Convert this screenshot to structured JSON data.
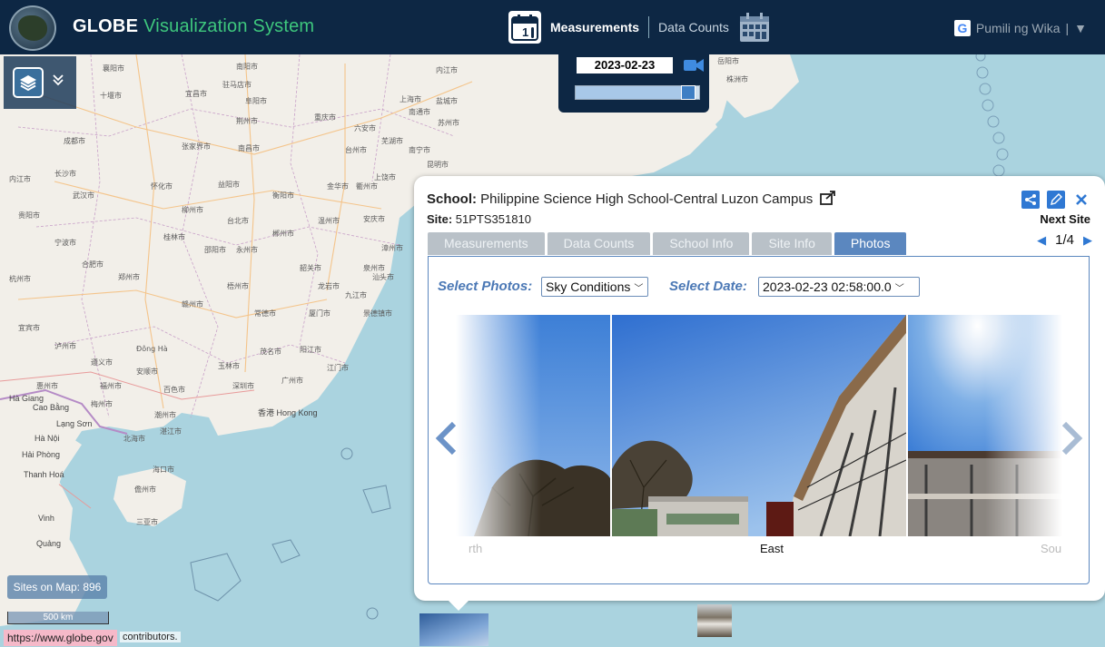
{
  "header": {
    "title_part1": "GLOBE",
    "title_part2": "Visualization System",
    "nav": {
      "measurements_label": "Measurements",
      "data_counts_label": "Data Counts",
      "calendar_day": "1"
    },
    "language_label": "Pumili ng Wika",
    "language_separator": "|",
    "language_caret": "▼",
    "google_letter": "G"
  },
  "date_widget": {
    "date": "2023-02-23",
    "slider_value": 0.97
  },
  "map": {
    "sites_on_map": "Sites on Map: 896",
    "scale_label": "500 km",
    "url": "https://www.globe.gov",
    "attribution": "contributors.",
    "place_labels": [
      "香港 Hong Kong",
      "Hà Nội",
      "Hải Phòng",
      "Thanh Hoá",
      "Vinh",
      "Hà Giang",
      "Lạng Sơn",
      "Cao Bằng",
      "海口市",
      "儋州市",
      "三亚市",
      "湛江市",
      "北海市",
      "广州市",
      "深圳市",
      "汕头市",
      "厦门市",
      "福州市",
      "温州市",
      "台北市",
      "南昌市",
      "长沙市",
      "武汉市",
      "贵阳市",
      "南宁市",
      "昆明市",
      "重庆市",
      "成都市",
      "杭州市",
      "宁波市",
      "合肥市",
      "郑州市",
      "十堰市",
      "襄阳市",
      "宜昌市",
      "荆州市",
      "张家界市",
      "怀化市",
      "柳州市",
      "桂林市",
      "梧州市",
      "韶关市",
      "赣州市",
      "龙岩市",
      "泉州市",
      "漳州市",
      "九江市",
      "景德镇市",
      "上饶市",
      "衢州市",
      "金华市",
      "台州市",
      "安庆市",
      "黄山市",
      "信阳市",
      "南阳市",
      "驻马店市",
      "阜阳市",
      "六安市",
      "芜湖市",
      "苏州市",
      "上海市",
      "南通市",
      "盐城市",
      "内江市",
      "自贡市",
      "宜宾市",
      "泸州市",
      "遵义市",
      "安顺市",
      "百色市",
      "玉林市",
      "茂名市",
      "阳江市",
      "江门市",
      "惠州市",
      "梅州市",
      "潮州市",
      "岳阳市",
      "株洲市",
      "衡阳市",
      "永州市",
      "郴州市",
      "邵阳市",
      "益阳市",
      "常德市",
      "Đông Hà",
      "Quảng"
    ]
  },
  "popup": {
    "school_label": "School:",
    "school_name": "Philippine Science High School-Central Luzon Campus",
    "site_label": "Site:",
    "site_id": "51PTS351810",
    "next_site_label": "Next Site",
    "pager": "1/4",
    "tabs": [
      "Measurements",
      "Data Counts",
      "School Info",
      "Site Info",
      "Photos"
    ],
    "active_tab": "Photos",
    "select_photos_label": "Select Photos:",
    "select_photos_value": "Sky Conditions",
    "select_date_label": "Select Date:",
    "select_date_value": "2023-02-23 02:58:00.0",
    "photo_captions": [
      "rth",
      "East",
      "Sou"
    ]
  },
  "colors": {
    "header_bg": "#0d2744",
    "title_accent": "#3ec77d",
    "tab_active": "#5b87bf",
    "tab_inactive": "#b9c1c8",
    "accent_blue": "#2f78d3",
    "label_blue": "#4b78b5",
    "map_water": "#aad3df",
    "map_land": "#f2efe9"
  },
  "icons": [
    "globe-logo-icon",
    "calendar-icon",
    "calendar-grid-icon",
    "google-icon",
    "layers-icon",
    "chevron-down-icon",
    "video-camera-icon",
    "external-link-icon",
    "share-icon",
    "edit-pencil-icon",
    "close-icon",
    "triangle-left-icon",
    "triangle-right-icon",
    "carousel-prev-icon",
    "carousel-next-icon",
    "dropdown-chevron-icon"
  ]
}
